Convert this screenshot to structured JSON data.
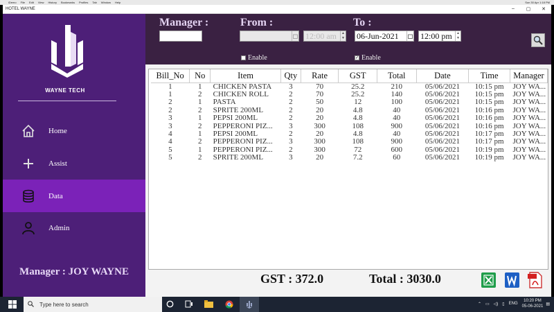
{
  "mac_menu": {
    "apple": "",
    "items": [
      "iDemo",
      "File",
      "Edit",
      "View",
      "History",
      "Bookmarks",
      "Profiles",
      "Tab",
      "Window",
      "Help"
    ],
    "clock": "Sun 30 Apr 1:18 PM"
  },
  "window": {
    "title": "HOTEL WAYNE",
    "minimize": "–",
    "maximize": "▢",
    "close": "✕"
  },
  "sidebar": {
    "brand": "WAYNE TECH",
    "items": [
      {
        "label": "Home",
        "icon": "home-icon",
        "active": false
      },
      {
        "label": "Assist",
        "icon": "plus-icon",
        "active": false
      },
      {
        "label": "Data",
        "icon": "database-icon",
        "active": true
      },
      {
        "label": "Admin",
        "icon": "user-icon",
        "active": false
      }
    ],
    "footer": "Manager : JOY WAYNE",
    "accent": "#7b22b8",
    "bg": "#4d1f78"
  },
  "filters": {
    "manager_label": "Manager :",
    "manager_value": "",
    "from_label": "From :",
    "from_date": "",
    "from_time": "12:00 am",
    "from_enable_label": "Enable",
    "from_enable_checked": false,
    "to_label": "To :",
    "to_date": "06-Jun-2021",
    "to_time": "12:00 pm",
    "to_enable_label": "Enable",
    "to_enable_checked": true,
    "check_mark": "✓"
  },
  "table": {
    "columns": [
      "Bill_No",
      "No",
      "Item",
      "Qty",
      "Rate",
      "GST",
      "Total",
      "Date",
      "Time",
      "Manager"
    ],
    "rows": [
      [
        "1",
        "1",
        "CHICKEN PASTA",
        "3",
        "70",
        "25.2",
        "210",
        "05/06/2021",
        "10:15 pm",
        "JOY WA..."
      ],
      [
        "1",
        "2",
        "CHICKEN ROLL",
        "2",
        "70",
        "25.2",
        "140",
        "05/06/2021",
        "10:15 pm",
        "JOY WA..."
      ],
      [
        "2",
        "1",
        "PASTA",
        "2",
        "50",
        "12",
        "100",
        "05/06/2021",
        "10:15 pm",
        "JOY WA..."
      ],
      [
        "2",
        "2",
        "SPRITE 200ML",
        "2",
        "20",
        "4.8",
        "40",
        "05/06/2021",
        "10:16 pm",
        "JOY WA..."
      ],
      [
        "3",
        "1",
        "PEPSI 200ML",
        "2",
        "20",
        "4.8",
        "40",
        "05/06/2021",
        "10:16 pm",
        "JOY WA..."
      ],
      [
        "3",
        "2",
        "PEPPERONI PIZ...",
        "3",
        "300",
        "108",
        "900",
        "05/06/2021",
        "10:16 pm",
        "JOY WA..."
      ],
      [
        "4",
        "1",
        "PEPSI 200ML",
        "2",
        "20",
        "4.8",
        "40",
        "05/06/2021",
        "10:17 pm",
        "JOY WA..."
      ],
      [
        "4",
        "2",
        "PEPPERONI PIZ...",
        "3",
        "300",
        "108",
        "900",
        "05/06/2021",
        "10:17 pm",
        "JOY WA..."
      ],
      [
        "5",
        "1",
        "PEPPERONI PIZ...",
        "2",
        "300",
        "72",
        "600",
        "05/06/2021",
        "10:19 pm",
        "JOY WA..."
      ],
      [
        "5",
        "2",
        "SPRITE 200ML",
        "3",
        "20",
        "7.2",
        "60",
        "05/06/2021",
        "10:19 pm",
        "JOY WA..."
      ]
    ]
  },
  "totals": {
    "gst": "GST : 372.0",
    "total": "Total : 3030.0"
  },
  "export": [
    "excel-icon",
    "word-icon",
    "pdf-icon"
  ],
  "taskbar": {
    "search_placeholder": "Type here to search",
    "lang": "ENG",
    "time": "10:20 PM",
    "date": "05-06-2021"
  }
}
